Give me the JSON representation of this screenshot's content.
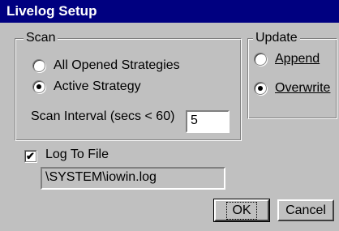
{
  "window": {
    "title": "Livelog Setup"
  },
  "scan": {
    "label": "Scan",
    "options": [
      "All Opened Strategies",
      "Active Strategy"
    ],
    "selected": 1,
    "interval_label": "Scan Interval (secs < 60)",
    "interval_value": "5"
  },
  "update": {
    "label": "Update",
    "options": [
      "Append",
      "Overwrite"
    ],
    "selected": 1
  },
  "log": {
    "checkbox_label": "Log To File",
    "checked": true,
    "path": "\\SYSTEM\\iowin.log"
  },
  "buttons": {
    "ok": "OK",
    "cancel": "Cancel"
  }
}
